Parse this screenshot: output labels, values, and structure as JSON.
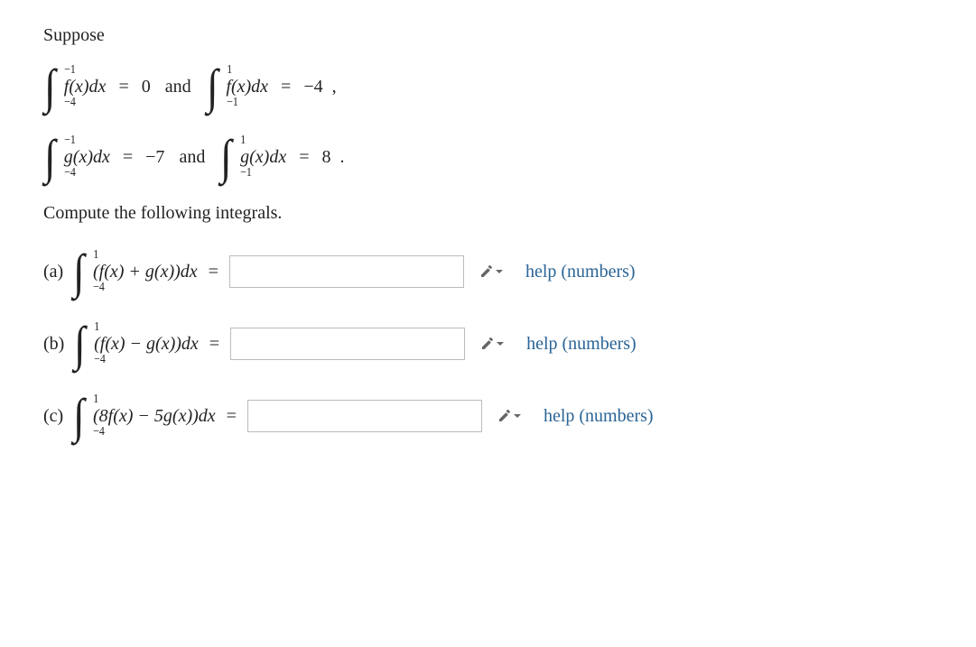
{
  "intro": "Suppose",
  "given": {
    "f1": {
      "lower": "−4",
      "upper": "−1",
      "body": "f(x)dx",
      "value": "0"
    },
    "f2": {
      "lower": "−1",
      "upper": "1",
      "body": "f(x)dx",
      "value": "−4"
    },
    "g1": {
      "lower": "−4",
      "upper": "−1",
      "body": "g(x)dx",
      "value": "−7"
    },
    "g2": {
      "lower": "−1",
      "upper": "1",
      "body": "g(x)dx",
      "value": "8"
    },
    "and": "and",
    "comma": ",",
    "period": "."
  },
  "compute": "Compute the following integrals.",
  "parts": {
    "a": {
      "label": "(a)",
      "lower": "−4",
      "upper": "1",
      "body": "(f(x) + g(x))dx"
    },
    "b": {
      "label": "(b)",
      "lower": "−4",
      "upper": "1",
      "body": "(f(x) − g(x))dx"
    },
    "c": {
      "label": "(c)",
      "lower": "−4",
      "upper": "1",
      "body": "(8f(x) − 5g(x))dx"
    }
  },
  "equals": "=",
  "help": {
    "text": "help (numbers)"
  },
  "inputs": {
    "a": "",
    "b": "",
    "c": ""
  }
}
